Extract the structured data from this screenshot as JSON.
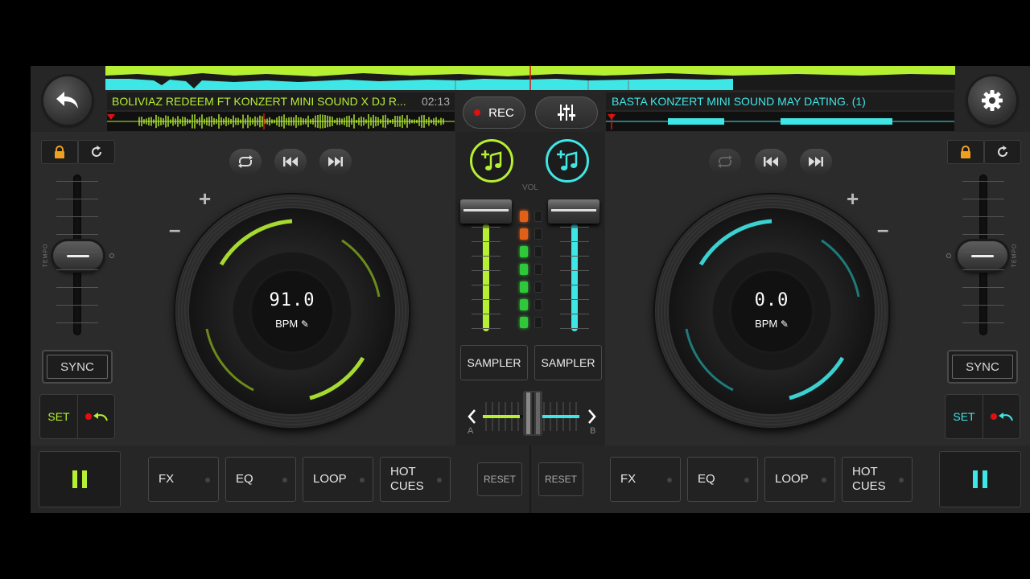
{
  "deck_a": {
    "track_title": "BOLIVIAZ REDEEM FT KONZERT MINI SOUND X DJ R...",
    "time": "02:13",
    "bpm": "91.0",
    "bpm_label": "BPM",
    "sync_label": "SYNC",
    "set_label": "SET",
    "tempo_label": "TEMPO",
    "color": "#b6f032"
  },
  "deck_b": {
    "track_title": "BASTA KONZERT MINI SOUND MAY DATING. (1)",
    "bpm": "0.0",
    "bpm_label": "BPM",
    "sync_label": "SYNC",
    "set_label": "SET",
    "tempo_label": "TEMPO",
    "color": "#3fe6e6"
  },
  "mixer": {
    "rec_label": "REC",
    "vol_label": "VOL",
    "sampler_a": "SAMPLER",
    "sampler_b": "SAMPLER",
    "cross_a": "A",
    "cross_b": "B"
  },
  "bottom": {
    "fx": "FX",
    "eq": "EQ",
    "loop": "LOOP",
    "hot_cues_1": "HOT",
    "hot_cues_2": "CUES",
    "reset": "RESET"
  }
}
